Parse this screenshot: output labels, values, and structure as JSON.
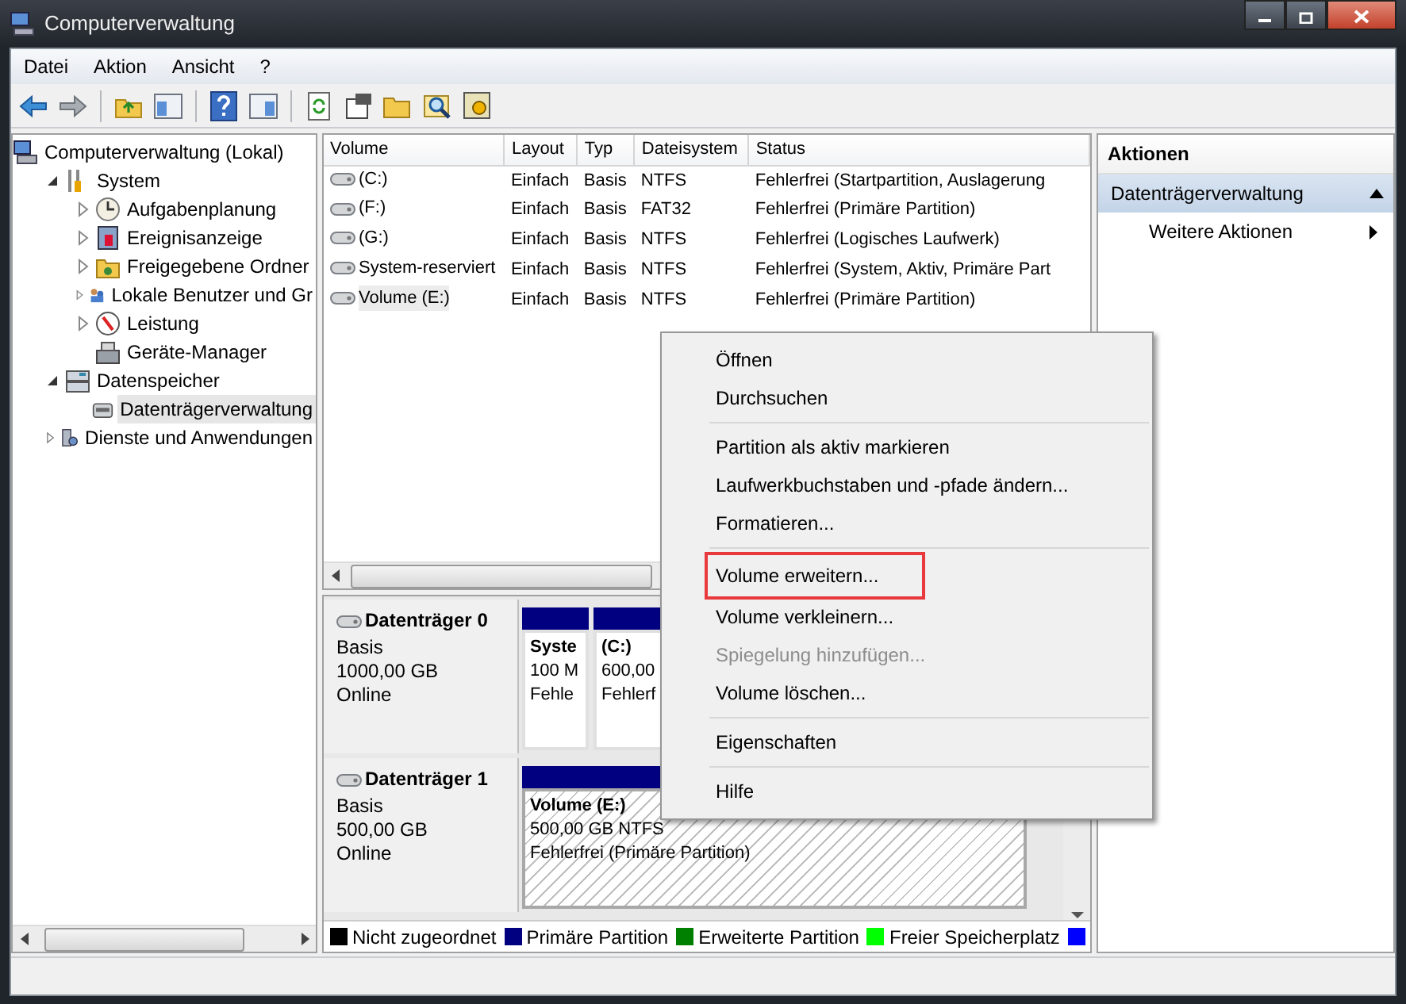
{
  "window": {
    "title": "Computerverwaltung"
  },
  "menu": [
    "Datei",
    "Aktion",
    "Ansicht",
    "?"
  ],
  "tree": [
    {
      "label": "Computerverwaltung (Lokal)",
      "kind": "root",
      "selected": false,
      "children": [
        {
          "label": "System",
          "kind": "node",
          "expanded": true,
          "selected": false,
          "children": [
            {
              "label": "Aufgabenplanung",
              "kind": "node",
              "expanded": false,
              "selected": false
            },
            {
              "label": "Ereignisanzeige",
              "kind": "node",
              "expanded": false,
              "selected": false
            },
            {
              "label": "Freigegebene Ordner",
              "kind": "node",
              "expanded": false,
              "selected": false
            },
            {
              "label": "Lokale Benutzer und Gr",
              "kind": "node",
              "expanded": false,
              "selected": false
            },
            {
              "label": "Leistung",
              "kind": "node",
              "expanded": false,
              "selected": false
            },
            {
              "label": "Geräte-Manager",
              "kind": "leaf",
              "selected": false
            }
          ]
        },
        {
          "label": "Datenspeicher",
          "kind": "node",
          "expanded": true,
          "selected": false,
          "children": [
            {
              "label": "Datenträgerverwaltung",
              "kind": "leaf",
              "selected": true
            }
          ]
        },
        {
          "label": "Dienste und Anwendungen",
          "kind": "node",
          "expanded": false,
          "selected": false
        }
      ]
    }
  ],
  "volumes": {
    "columns": [
      "Volume",
      "Layout",
      "Typ",
      "Dateisystem",
      "Status"
    ],
    "rows": [
      {
        "cells": [
          "(C:)",
          "Einfach",
          "Basis",
          "NTFS",
          "Fehlerfrei (Startpartition, Auslagerung"
        ],
        "selected": false
      },
      {
        "cells": [
          "(F:)",
          "Einfach",
          "Basis",
          "FAT32",
          "Fehlerfrei (Primäre Partition)"
        ],
        "selected": false
      },
      {
        "cells": [
          "(G:)",
          "Einfach",
          "Basis",
          "NTFS",
          "Fehlerfrei (Logisches Laufwerk)"
        ],
        "selected": false
      },
      {
        "cells": [
          "System-reserviert",
          "Einfach",
          "Basis",
          "NTFS",
          "Fehlerfrei (System, Aktiv, Primäre Part"
        ],
        "selected": false
      },
      {
        "cells": [
          "Volume (E:)",
          "Einfach",
          "Basis",
          "NTFS",
          "Fehlerfrei (Primäre Partition)"
        ],
        "selected": true
      }
    ]
  },
  "disks": [
    {
      "name": "Datenträger 0",
      "type": "Basis",
      "size": "1000,00 GB",
      "state": "Online",
      "partitions": [
        {
          "name": "Syste",
          "size": "100 M",
          "status": "Fehle",
          "selected": false
        },
        {
          "name": "(C:)",
          "size": "600,00",
          "status": "Fehlerf",
          "selected": false
        }
      ]
    },
    {
      "name": "Datenträger 1",
      "type": "Basis",
      "size": "500,00 GB",
      "state": "Online",
      "partitions": [
        {
          "name": "Volume  (E:)",
          "size": "500,00 GB NTFS",
          "status": "Fehlerfrei (Primäre Partition)",
          "selected": true
        }
      ]
    }
  ],
  "legend": [
    {
      "label": "Nicht zugeordnet",
      "color": "#000000"
    },
    {
      "label": "Primäre Partition",
      "color": "#000080"
    },
    {
      "label": "Erweiterte Partition",
      "color": "#008000"
    },
    {
      "label": "Freier Speicherplatz",
      "color": "#00ff00"
    },
    {
      "color": "#0000ff"
    }
  ],
  "actions": {
    "title": "Aktionen",
    "section": "Datenträgerverwaltung",
    "items": [
      "Weitere Aktionen"
    ]
  },
  "context_menu": [
    [
      {
        "label": "Öffnen",
        "disabled": false,
        "annotated": false
      },
      {
        "label": "Durchsuchen",
        "disabled": false,
        "annotated": false
      }
    ],
    [
      {
        "label": "Partition als aktiv markieren",
        "disabled": false,
        "annotated": false
      },
      {
        "label": "Laufwerkbuchstaben und -pfade ändern...",
        "disabled": false,
        "annotated": false
      },
      {
        "label": "Formatieren...",
        "disabled": false,
        "annotated": false
      }
    ],
    [
      {
        "label": "Volume erweitern...",
        "disabled": false,
        "annotated": true
      },
      {
        "label": "Volume verkleinern...",
        "disabled": false,
        "annotated": false
      },
      {
        "label": "Spiegelung hinzufügen...",
        "disabled": true,
        "annotated": false
      },
      {
        "label": "Volume löschen...",
        "disabled": false,
        "annotated": false
      }
    ],
    [
      {
        "label": "Eigenschaften",
        "disabled": false,
        "annotated": false
      }
    ],
    [
      {
        "label": "Hilfe",
        "disabled": false,
        "annotated": false
      }
    ]
  ]
}
